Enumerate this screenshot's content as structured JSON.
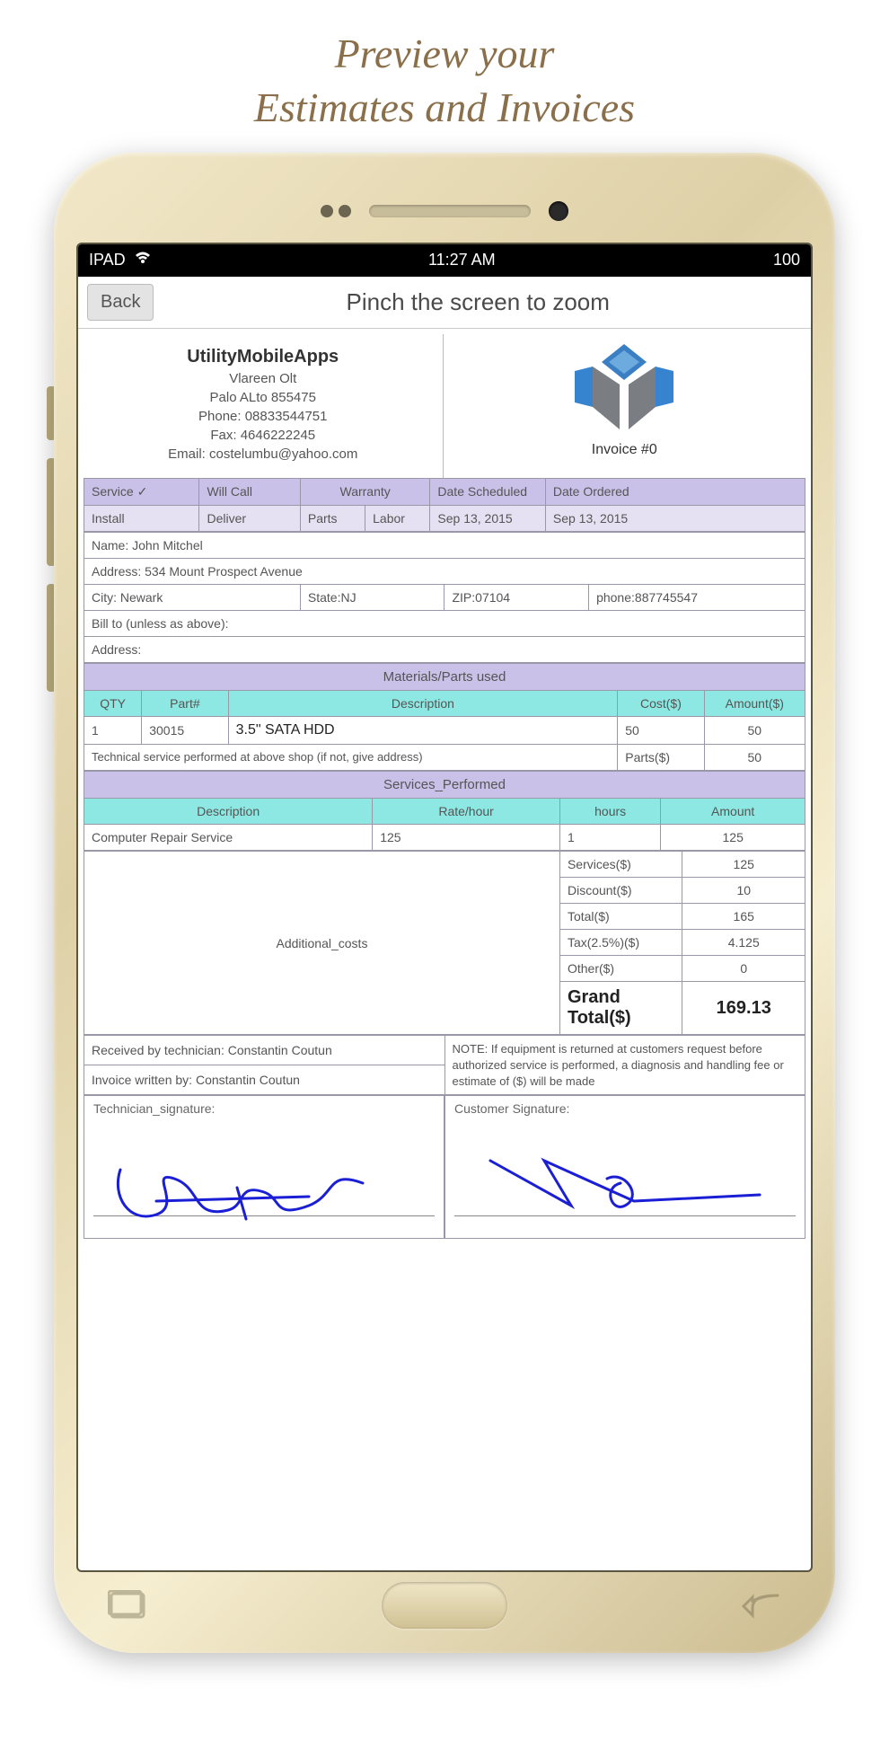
{
  "promo": {
    "line1": "Preview your",
    "line2": "Estimates and Invoices"
  },
  "status_bar": {
    "device": "IPAD",
    "time": "11:27 AM",
    "battery": "100"
  },
  "header": {
    "back_label": "Back",
    "title": "Pinch the screen to zoom"
  },
  "company": {
    "name": "UtilityMobileApps",
    "street": "Vlareen Olt",
    "city": "Palo ALto 855475",
    "phone_label": "Phone:",
    "phone": "08833544751",
    "fax_label": "Fax:",
    "fax": "4646222245",
    "email_label": "Email:",
    "email": "costelumbu@yahoo.com"
  },
  "invoice": {
    "label": "Invoice #0"
  },
  "type_row": {
    "service": "Service ✓",
    "will_call": "Will Call",
    "warranty": "Warranty",
    "date_scheduled": "Date Scheduled",
    "date_ordered": "Date Ordered"
  },
  "type_row2": {
    "install": "Install",
    "deliver": "Deliver",
    "parts": "Parts",
    "labor": "Labor",
    "date_scheduled_val": "Sep 13, 2015",
    "date_ordered_val": "Sep 13, 2015"
  },
  "customer": {
    "name_label": "Name:",
    "name": "John Mitchel",
    "address_label": "Address:",
    "address": "534 Mount Prospect Avenue",
    "city_label": "City:",
    "city": "Newark",
    "state_label": "State:",
    "state": "NJ",
    "zip_label": "ZIP:",
    "zip": "07104",
    "phone_label": "phone:",
    "phone": "887745547",
    "billto_label": "Bill to (unless as above):",
    "address2_label": "Address:"
  },
  "materials": {
    "section": "Materials/Parts used",
    "cols": {
      "qty": "QTY",
      "part": "Part#",
      "desc": "Description",
      "cost": "Cost($)",
      "amount": "Amount($)"
    },
    "rows": [
      {
        "qty": "1",
        "part": "30015",
        "desc": "3.5\" SATA HDD",
        "cost": "50",
        "amount": "50"
      }
    ],
    "tech_note": "Technical service performed at above shop (if not, give address)",
    "parts_label": "Parts($)",
    "parts_total": "50"
  },
  "services": {
    "section": "Services_Performed",
    "cols": {
      "desc": "Description",
      "rate": "Rate/hour",
      "hours": "hours",
      "amount": "Amount"
    },
    "rows": [
      {
        "desc": "Computer Repair Service",
        "rate": "125",
        "hours": "1",
        "amount": "125"
      }
    ]
  },
  "totals": {
    "additional_costs": "Additional_costs",
    "lines": [
      {
        "label": "Services($)",
        "value": "125"
      },
      {
        "label": "Discount($)",
        "value": "10"
      },
      {
        "label": "Total($)",
        "value": "165"
      },
      {
        "label": "Tax(2.5%)($)",
        "value": "4.125"
      },
      {
        "label": "Other($)",
        "value": "0"
      }
    ],
    "grand_label": "Grand Total($)",
    "grand_value": "169.13"
  },
  "footer": {
    "received_label": "Received by technician:",
    "received_name": "Constantin Coutun",
    "written_label": "Invoice written by:",
    "written_name": "Constantin Coutun",
    "note": "NOTE: If equipment is returned at customers request before authorized service is performed, a diagnosis and handling fee or estimate of ($) will be made",
    "tech_sig": "Technician_signature:",
    "cust_sig": "Customer Signature:"
  }
}
